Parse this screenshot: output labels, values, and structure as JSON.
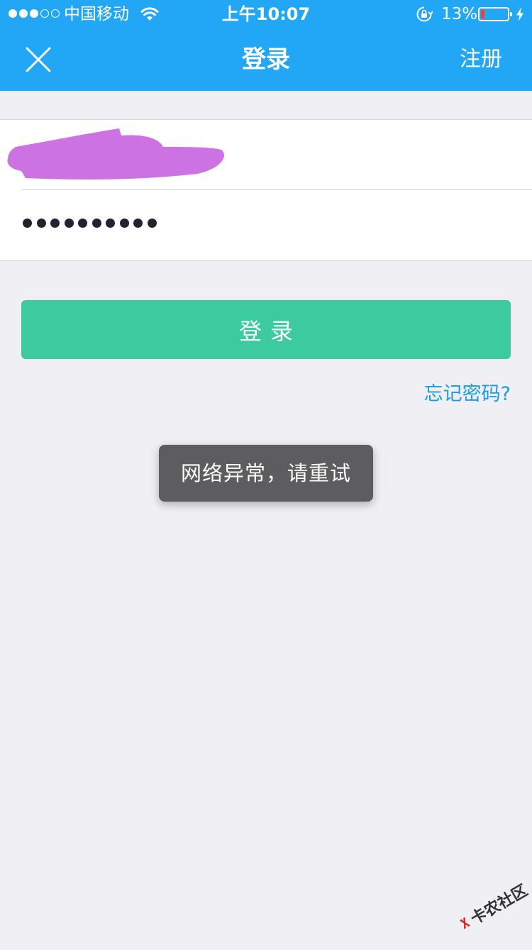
{
  "status_bar": {
    "carrier": "中国移动",
    "time": "上午10:07",
    "battery_percent_text": "13%",
    "battery_level": 0.13,
    "signal_strength": 3,
    "signal_max": 5,
    "wifi_icon": "wifi-icon",
    "rotation_lock_icon": "rotation-lock-icon",
    "charging_icon": "charging-bolt-icon"
  },
  "nav": {
    "close_icon": "close-icon",
    "title": "登录",
    "register_label": "注册"
  },
  "form": {
    "username_value": "",
    "password_masked_length": 10
  },
  "login_button_label": "登录",
  "forgot_password_label": "忘记密码?",
  "toast_message": "网络异常，请重试",
  "watermark_text": "卡农社区",
  "colors": {
    "header_bg": "#22a6f6",
    "page_bg": "#efeff4",
    "login_button": "#3ccb9e",
    "link": "#1a9ce8",
    "toast_bg": "#5d5d5f",
    "redaction": "#cd72e3",
    "battery_low": "#ff3b30"
  }
}
